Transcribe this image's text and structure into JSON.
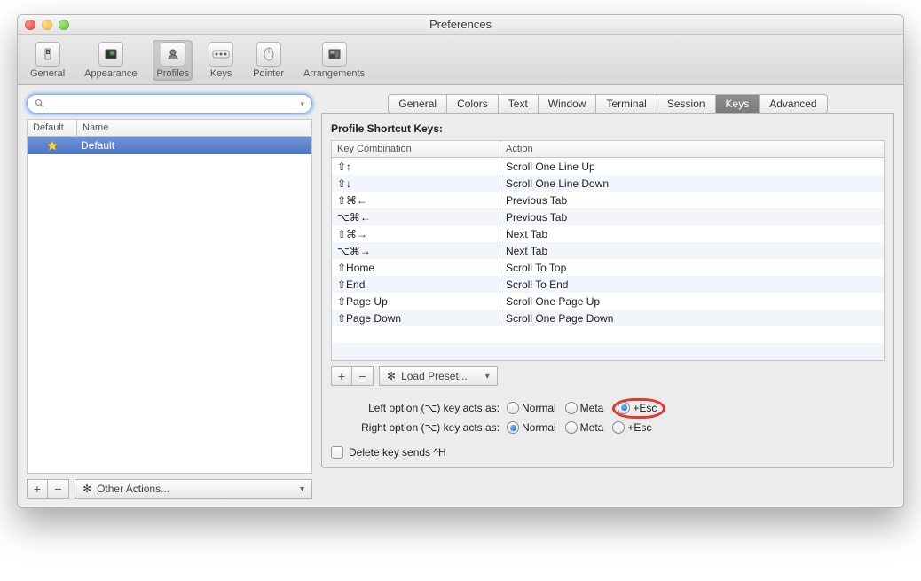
{
  "window": {
    "title": "Preferences"
  },
  "toolbar": [
    {
      "label": "General"
    },
    {
      "label": "Appearance"
    },
    {
      "label": "Profiles"
    },
    {
      "label": "Keys"
    },
    {
      "label": "Pointer"
    },
    {
      "label": "Arrangements"
    }
  ],
  "search": {
    "placeholder": ""
  },
  "profile_columns": {
    "c1": "Default",
    "c2": "Name"
  },
  "profiles": [
    {
      "name": "Default",
      "starred": true
    }
  ],
  "left_actions": {
    "add": "+",
    "remove": "−",
    "dropdown": "Other Actions..."
  },
  "subtabs": [
    "General",
    "Colors",
    "Text",
    "Window",
    "Terminal",
    "Session",
    "Keys",
    "Advanced"
  ],
  "subtab_selected": "Keys",
  "panel_heading": "Profile Shortcut Keys:",
  "keys_columns": {
    "c1": "Key Combination",
    "c2": "Action"
  },
  "keys": [
    {
      "combo": "⇧↑",
      "action": "Scroll One Line Up"
    },
    {
      "combo": "⇧↓",
      "action": "Scroll One Line Down"
    },
    {
      "combo": "⇧⌘←",
      "action": "Previous Tab"
    },
    {
      "combo": "⌥⌘←",
      "action": "Previous Tab"
    },
    {
      "combo": "⇧⌘→",
      "action": "Next Tab"
    },
    {
      "combo": "⌥⌘→",
      "action": "Next Tab"
    },
    {
      "combo": "⇧Home",
      "action": "Scroll To Top"
    },
    {
      "combo": "⇧End",
      "action": "Scroll To End"
    },
    {
      "combo": "⇧Page Up",
      "action": "Scroll One Page Up"
    },
    {
      "combo": "⇧Page Down",
      "action": "Scroll One Page Down"
    }
  ],
  "keys_footer": {
    "add": "+",
    "remove": "−",
    "preset": "Load Preset..."
  },
  "options": {
    "left_label": "Left option (⌥) key acts as:",
    "right_label": "Right option (⌥) key acts as:",
    "radio_labels": {
      "normal": "Normal",
      "meta": "Meta",
      "esc": "+Esc"
    },
    "left_value": "esc",
    "right_value": "normal",
    "delete_label": "Delete key sends ^H",
    "delete_checked": false
  }
}
